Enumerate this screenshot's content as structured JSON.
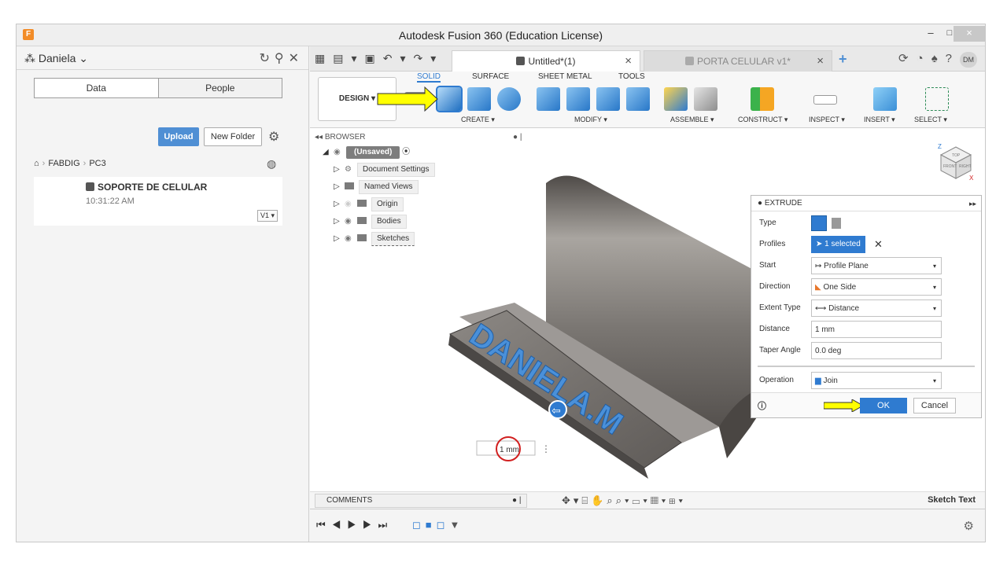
{
  "window": {
    "title": "Autodesk Fusion 360 (Education License)",
    "minimize": "–",
    "maximize": "□",
    "close": "×"
  },
  "data_panel": {
    "user": "Daniela",
    "segment": {
      "data": "Data",
      "people": "People"
    },
    "upload_label": "Upload",
    "new_folder_label": "New Folder",
    "breadcrumb": [
      "FABDIG",
      "PC3"
    ],
    "file": {
      "name": "SOPORTE DE CELULAR",
      "time": "10:31:22 AM",
      "version": "V1 ▾"
    }
  },
  "tabs": [
    {
      "label": "Untitled*(1)",
      "active": true
    },
    {
      "label": "PORTA CELULAR v1*",
      "active": false
    }
  ],
  "avatar_initials": "DM",
  "toolbar": {
    "workspace": "DESIGN ▾",
    "mode_tabs": [
      "SOLID",
      "SURFACE",
      "SHEET METAL",
      "TOOLS"
    ],
    "groups": [
      "CREATE ▾",
      "MODIFY ▾",
      "ASSEMBLE ▾",
      "CONSTRUCT ▾",
      "INSPECT ▾",
      "INSERT ▾",
      "SELECT ▾"
    ]
  },
  "browser": {
    "header": "BROWSER",
    "root": "(Unsaved)",
    "items": [
      "Document Settings",
      "Named Views",
      "Origin",
      "Bodies",
      "Sketches"
    ]
  },
  "viewcube": {
    "axis_z": "Z",
    "axis_x": "X",
    "top": "TOP",
    "front": "FRONT",
    "right": "RIGHT"
  },
  "model_text": "DANIELA.M",
  "distance_input": "1 mm",
  "extrude": {
    "title": "EXTRUDE",
    "type_label": "Type",
    "profiles_label": "Profiles",
    "profiles_value": "1 selected",
    "start_label": "Start",
    "start_value": "Profile Plane",
    "direction_label": "Direction",
    "direction_value": "One Side",
    "extent_label": "Extent Type",
    "extent_value": "Distance",
    "distance_label": "Distance",
    "distance_value": "1 mm",
    "taper_label": "Taper Angle",
    "taper_value": "0.0 deg",
    "operation_label": "Operation",
    "operation_value": "Join",
    "ok_label": "OK",
    "cancel_label": "Cancel"
  },
  "bottom": {
    "comments": "COMMENTS",
    "status": "Sketch Text"
  },
  "colors": {
    "accent": "#2f7bd0",
    "annotation_arrow": "#ffff00",
    "annotation_circle": "#d11f1f",
    "model_body": "#6e6a66",
    "model_text": "#4a90d9"
  }
}
